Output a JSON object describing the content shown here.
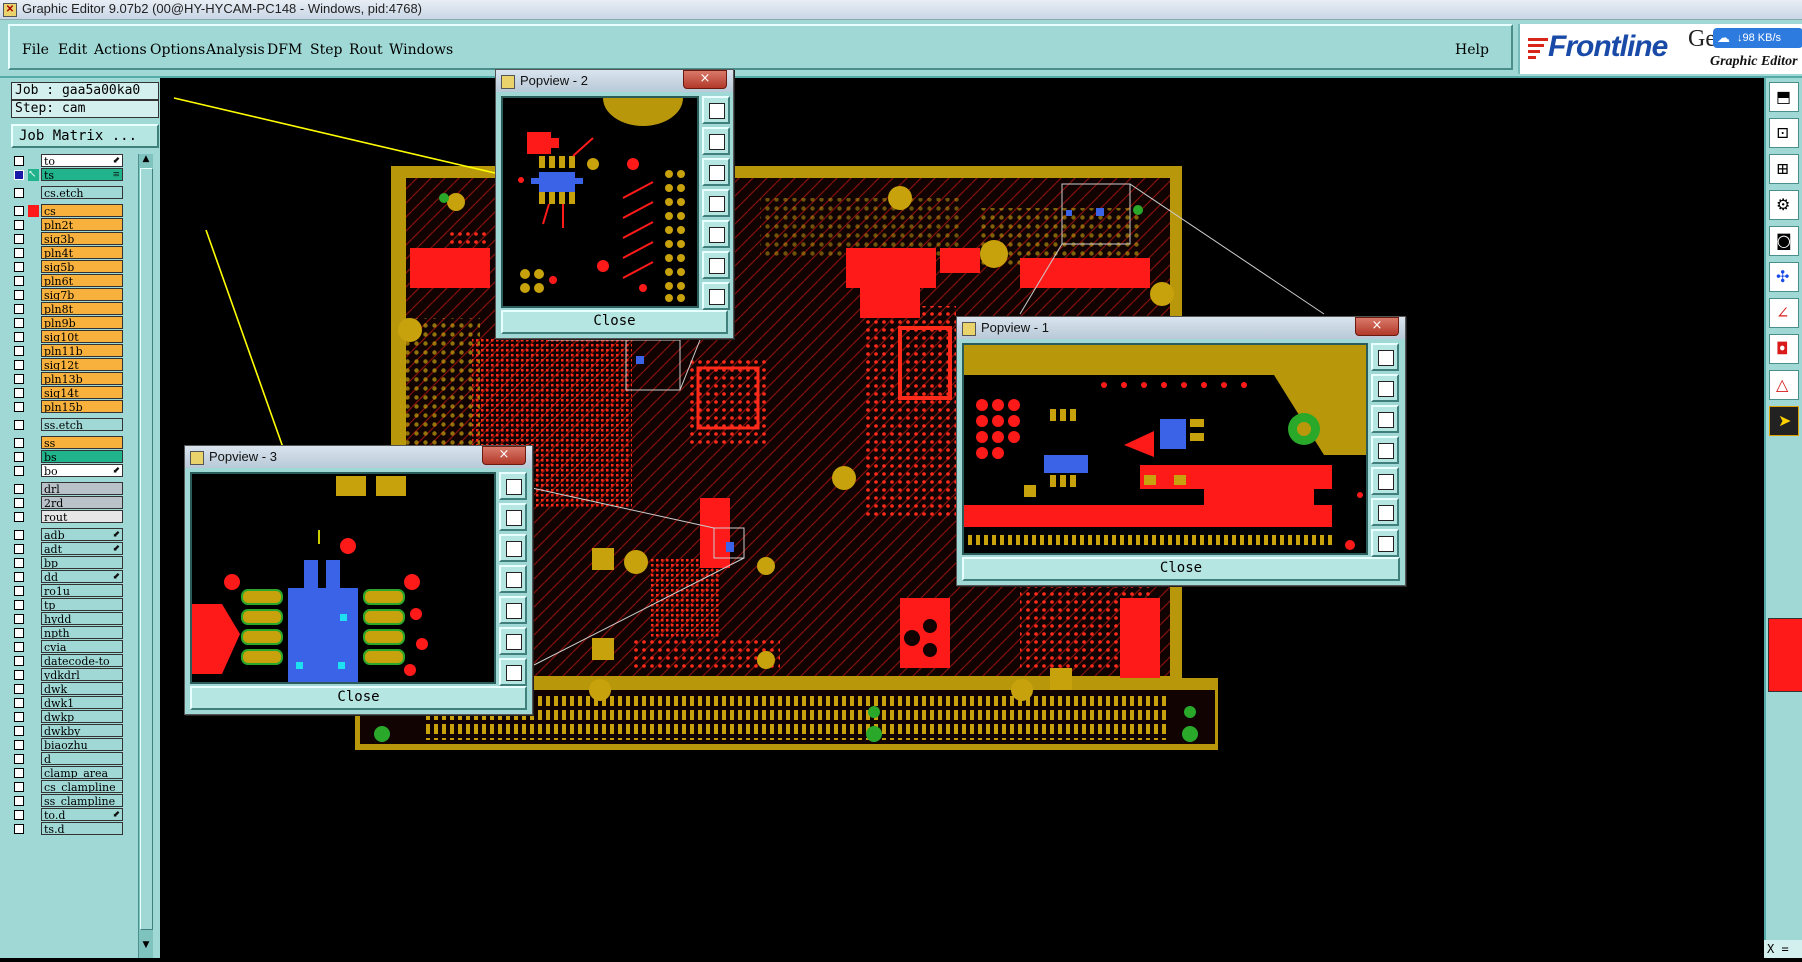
{
  "window": {
    "title": "Graphic Editor 9.07b2 (00@HY-HYCAM-PC148 - Windows, pid:4768)"
  },
  "menu": {
    "items": [
      "File",
      "Edit",
      "Actions",
      "Options",
      "Analysis",
      "DFM",
      "Step",
      "Rout",
      "Windows"
    ],
    "help": "Help"
  },
  "logo": {
    "brand": "Frontline",
    "product_prefix": "Ge",
    "subtitle": "Graphic Editor",
    "net_speed": "↓98 KB/s"
  },
  "job": {
    "job_line": "Job : gaa5a00ka0",
    "step_line": "Step: cam",
    "matrix_button": "Job Matrix ..."
  },
  "layers": [
    {
      "name": "to",
      "color": "#ffffff",
      "mark": "",
      "arrow": true
    },
    {
      "name": "ts",
      "color": "#21b48c",
      "mark": "pointer",
      "arrow": false,
      "active": true
    },
    {
      "name": "cs.etch",
      "color": "#9fd8d4",
      "mark": "",
      "arrow": false,
      "gap": true
    },
    {
      "name": "cs",
      "color": "#f7b13c",
      "mark": "red",
      "arrow": false,
      "gap": true
    },
    {
      "name": "pln2t",
      "color": "#f7b13c",
      "mark": "",
      "arrow": false
    },
    {
      "name": "sig3b",
      "color": "#f7b13c",
      "mark": "",
      "arrow": false
    },
    {
      "name": "pln4t",
      "color": "#f7b13c",
      "mark": "",
      "arrow": false
    },
    {
      "name": "sig5b",
      "color": "#f7b13c",
      "mark": "",
      "arrow": false
    },
    {
      "name": "pln6t",
      "color": "#f7b13c",
      "mark": "",
      "arrow": false
    },
    {
      "name": "sig7b",
      "color": "#f7b13c",
      "mark": "",
      "arrow": false
    },
    {
      "name": "pln8t",
      "color": "#f7b13c",
      "mark": "",
      "arrow": false
    },
    {
      "name": "pln9b",
      "color": "#f7b13c",
      "mark": "",
      "arrow": false
    },
    {
      "name": "sig10t",
      "color": "#f7b13c",
      "mark": "",
      "arrow": false
    },
    {
      "name": "pln11b",
      "color": "#f7b13c",
      "mark": "",
      "arrow": false
    },
    {
      "name": "sig12t",
      "color": "#f7b13c",
      "mark": "",
      "arrow": false
    },
    {
      "name": "pln13b",
      "color": "#f7b13c",
      "mark": "",
      "arrow": false
    },
    {
      "name": "sig14t",
      "color": "#f7b13c",
      "mark": "",
      "arrow": false
    },
    {
      "name": "pln15b",
      "color": "#f7b13c",
      "mark": "",
      "arrow": false
    },
    {
      "name": "ss.etch",
      "color": "#9fd8d4",
      "mark": "",
      "arrow": false,
      "gap": true
    },
    {
      "name": "ss",
      "color": "#f7b13c",
      "mark": "",
      "arrow": false,
      "gap": true
    },
    {
      "name": "bs",
      "color": "#21b48c",
      "mark": "",
      "arrow": false
    },
    {
      "name": "bo",
      "color": "#ffffff",
      "mark": "",
      "arrow": true
    },
    {
      "name": "drl",
      "color": "#b9c2c9",
      "mark": "",
      "arrow": false,
      "gap": true
    },
    {
      "name": "2rd",
      "color": "#b9c2c9",
      "mark": "",
      "arrow": false
    },
    {
      "name": "rout",
      "color": "#e6e6e6",
      "mark": "",
      "arrow": false
    },
    {
      "name": "adb",
      "color": "#9fd8d4",
      "mark": "",
      "arrow": true,
      "gap": true
    },
    {
      "name": "adt",
      "color": "#9fd8d4",
      "mark": "",
      "arrow": true
    },
    {
      "name": "bp",
      "color": "#9fd8d4",
      "mark": "",
      "arrow": false
    },
    {
      "name": "dd",
      "color": "#9fd8d4",
      "mark": "",
      "arrow": true
    },
    {
      "name": "ro1u",
      "color": "#9fd8d4",
      "mark": "",
      "arrow": false
    },
    {
      "name": "tp",
      "color": "#9fd8d4",
      "mark": "",
      "arrow": false
    },
    {
      "name": "hydd",
      "color": "#9fd8d4",
      "mark": "",
      "arrow": false
    },
    {
      "name": "npth",
      "color": "#9fd8d4",
      "mark": "",
      "arrow": false
    },
    {
      "name": "cvia",
      "color": "#9fd8d4",
      "mark": "",
      "arrow": false
    },
    {
      "name": "datecode-to",
      "color": "#9fd8d4",
      "mark": "",
      "arrow": false
    },
    {
      "name": "ydkdrl",
      "color": "#9fd8d4",
      "mark": "",
      "arrow": false
    },
    {
      "name": "dwk",
      "color": "#9fd8d4",
      "mark": "",
      "arrow": false
    },
    {
      "name": "dwk1",
      "color": "#9fd8d4",
      "mark": "",
      "arrow": false
    },
    {
      "name": "dwkp",
      "color": "#9fd8d4",
      "mark": "",
      "arrow": false
    },
    {
      "name": "dwkby",
      "color": "#9fd8d4",
      "mark": "",
      "arrow": false
    },
    {
      "name": "biaozhu",
      "color": "#9fd8d4",
      "mark": "",
      "arrow": false
    },
    {
      "name": "d",
      "color": "#9fd8d4",
      "mark": "",
      "arrow": false
    },
    {
      "name": "clamp_area",
      "color": "#9fd8d4",
      "mark": "",
      "arrow": false
    },
    {
      "name": "cs_clampline",
      "color": "#9fd8d4",
      "mark": "",
      "arrow": false
    },
    {
      "name": "ss_clampline",
      "color": "#9fd8d4",
      "mark": "",
      "arrow": false
    },
    {
      "name": "to.d",
      "color": "#9fd8d4",
      "mark": "",
      "arrow": true
    },
    {
      "name": "ts.d",
      "color": "#9fd8d4",
      "mark": "",
      "arrow": false
    }
  ],
  "popups": {
    "p2": {
      "title": "Popview - 2",
      "close_x": "×",
      "close_label": "Close"
    },
    "p1": {
      "title": "Popview - 1",
      "close_x": "×",
      "close_label": "Close"
    },
    "p3": {
      "title": "Popview - 3",
      "close_x": "×",
      "close_label": "Close"
    }
  },
  "status": {
    "x_label": "X ="
  },
  "colors": {
    "panel": "#9fd8d4",
    "copper_red": "#ff1a1a",
    "gold": "#b8980a",
    "blue_component": "#3a63e8",
    "annotation_yellow": "#ffff00"
  }
}
